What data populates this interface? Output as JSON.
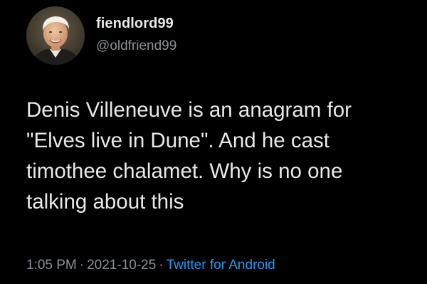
{
  "tweet": {
    "author": {
      "display_name": "fiendlord99",
      "handle": "@oldfriend99"
    },
    "text_lines": [
      "Denis Villeneuve is an anagram for",
      "\"Elves live in Dune\". And he cast",
      "timothee chalamet. Why is no one",
      "talking about this"
    ],
    "time": "1:05 PM",
    "separator": "·",
    "date": "2021-10-25",
    "source": "Twitter for Android"
  },
  "colors": {
    "background": "#000000",
    "text": "#e7e9ea",
    "secondary_text": "#8b9199",
    "link": "#1d9bf0"
  }
}
